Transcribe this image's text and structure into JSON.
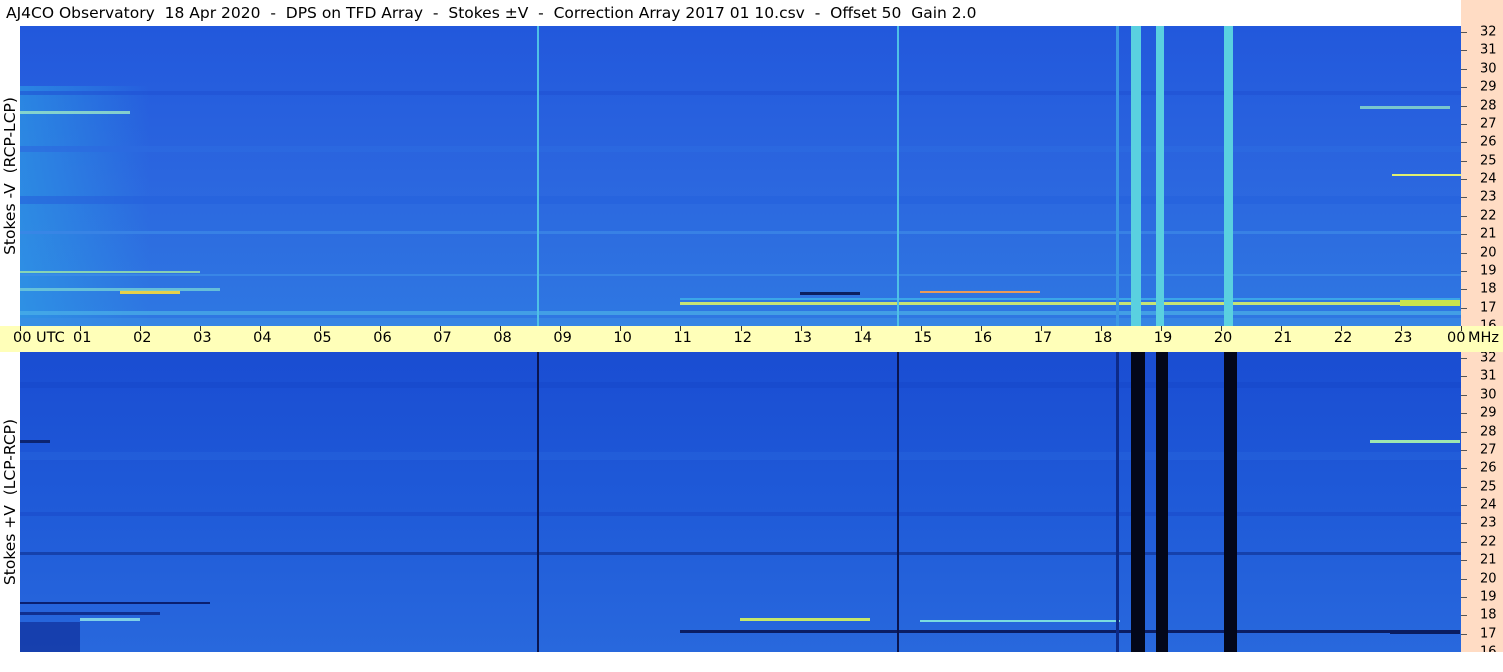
{
  "window": {
    "title": "AJ4CO Observatory  18 Apr 2020  -  DPS on TFD Array  -  Stokes ±V  -  Correction Array 2017 01 10.csv  -  Offset 50  Gain 2.0"
  },
  "panels": {
    "top": {
      "ylabel": "Stokes -V  (RCP-LCP)"
    },
    "bottom": {
      "ylabel": "Stokes +V  (LCP-RCP)"
    }
  },
  "freq_axis": {
    "labels": [
      "32",
      "31",
      "30",
      "29",
      "28",
      "27",
      "26",
      "25",
      "24",
      "23",
      "22",
      "21",
      "20",
      "19",
      "18",
      "17",
      "16"
    ]
  },
  "time_axis": {
    "labels": [
      "00",
      "01",
      "02",
      "03",
      "04",
      "05",
      "06",
      "07",
      "08",
      "09",
      "10",
      "11",
      "12",
      "13",
      "14",
      "15",
      "16",
      "17",
      "18",
      "19",
      "20",
      "21",
      "22",
      "23",
      "00"
    ],
    "utc_label": "UTC",
    "mhz_label": "MHz"
  },
  "colors": {
    "spectrogram_base_top": "#2a63dd",
    "spectrogram_base_bottom": "#1b50d3",
    "time_axis_bg": "#ffffb9",
    "freq_axis_bg": "#ffdcc4"
  }
}
